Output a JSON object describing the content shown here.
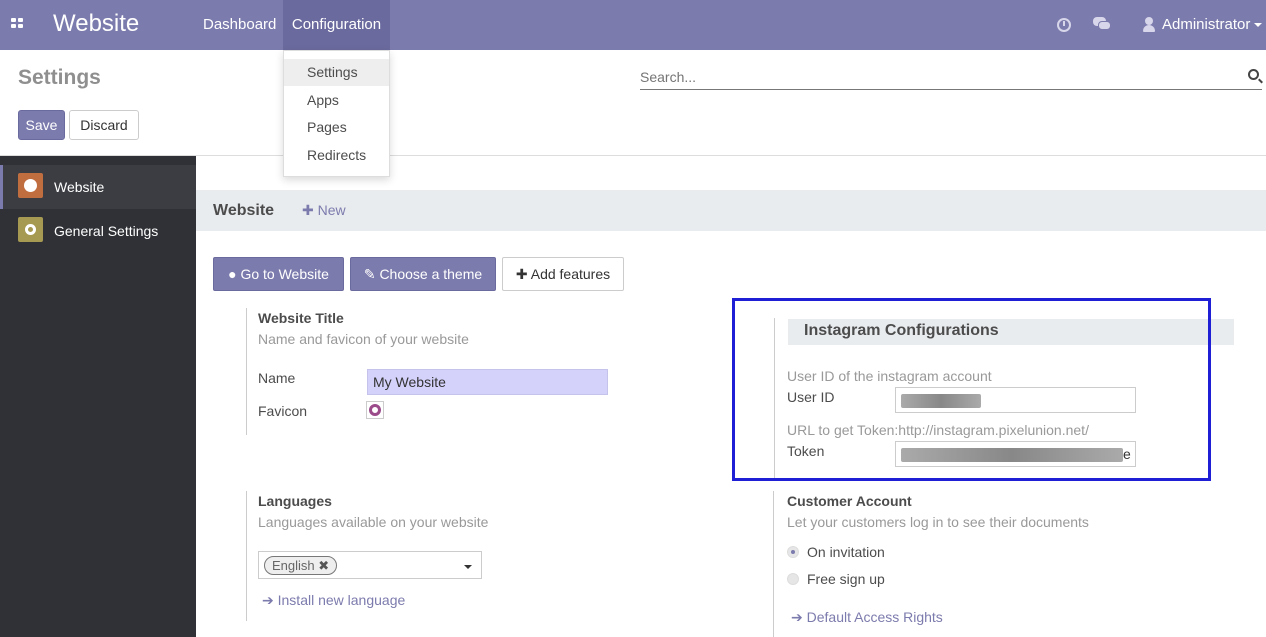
{
  "navbar": {
    "brand": "Website",
    "menu": [
      "Dashboard",
      "Configuration"
    ],
    "user": "Administrator"
  },
  "config_menu": [
    "Settings",
    "Apps",
    "Pages",
    "Redirects"
  ],
  "control_panel": {
    "title": "Settings",
    "search_placeholder": "Search...",
    "save": "Save",
    "discard": "Discard"
  },
  "sidebar": [
    {
      "label": "Website",
      "icon": "globe-icon"
    },
    {
      "label": "General Settings",
      "icon": "gear-icon"
    }
  ],
  "section": {
    "title": "Website",
    "new": "New"
  },
  "actions": {
    "go_to_website": "Go to Website",
    "choose_theme": "Choose a theme",
    "add_features": "Add features"
  },
  "website_title": {
    "title": "Website Title",
    "desc": "Name and favicon of your website",
    "name_label": "Name",
    "name_value": "My Website",
    "favicon_label": "Favicon"
  },
  "instagram": {
    "title": "Instagram Configurations",
    "user_id_desc": "User ID of the instagram account",
    "user_id_label": "User ID",
    "token_desc": "URL to get Token:http://instagram.pixelunion.net/",
    "token_label": "Token",
    "token_tail": "e"
  },
  "languages": {
    "title": "Languages",
    "desc": "Languages available on your website",
    "tag": "English",
    "install": "Install new language"
  },
  "customer_account": {
    "title": "Customer Account",
    "desc": "Let your customers log in to see their documents",
    "options": [
      "On invitation",
      "Free sign up"
    ],
    "link": "Default Access Rights"
  }
}
